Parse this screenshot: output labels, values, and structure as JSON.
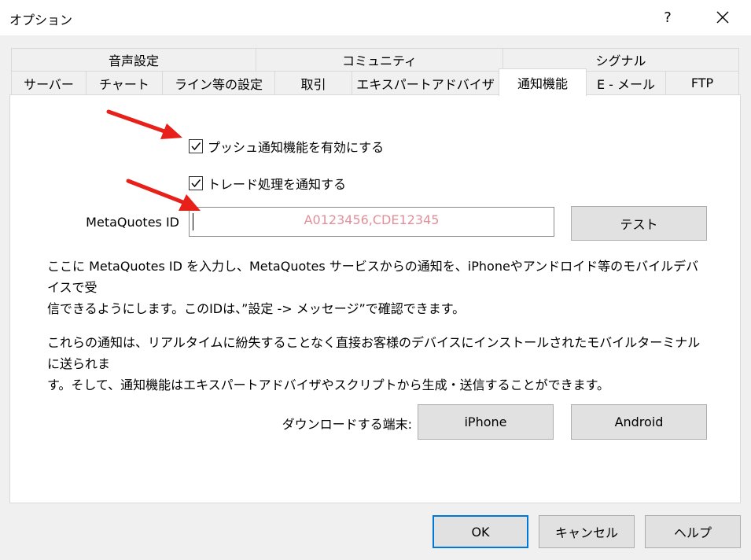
{
  "window": {
    "title": "オプション",
    "help_label": "?",
    "close_icon": "close-icon"
  },
  "tabs": {
    "row1": [
      {
        "label": "音声設定"
      },
      {
        "label": "コミュニティ"
      },
      {
        "label": "シグナル"
      }
    ],
    "row2": [
      {
        "label": "サーバー"
      },
      {
        "label": "チャート"
      },
      {
        "label": "ライン等の設定"
      },
      {
        "label": "取引"
      },
      {
        "label": "エキスパートアドバイザ"
      },
      {
        "label": "通知機能",
        "active": true
      },
      {
        "label": "E - メール"
      },
      {
        "label": "FTP"
      }
    ]
  },
  "notifications": {
    "push_checkbox": {
      "label": "プッシュ通知機能を有効にする",
      "checked": true
    },
    "trade_checkbox": {
      "label": "トレード処理を通知する",
      "checked": true
    },
    "id_label": "MetaQuotes ID",
    "id_value": "A0123456,CDE12345",
    "test_button": "テスト",
    "description1_line1": "ここに MetaQuotes ID を入力し、MetaQuotes サービスからの通知を、iPhoneやアンドロイド等のモバイルデバイスで受",
    "description1_line2": "信できるようにします。このIDは、”設定 -> メッセージ”で確認できます。",
    "description2_line1": "これらの通知は、リアルタイムに紛失することなく直接お客様のデバイスにインストールされたモバイルターミナルに送られま",
    "description2_line2": "す。そして、通知機能はエキスパートアドバイザやスクリプトから生成・送信することができます。",
    "download_label": "ダウンロードする端末:",
    "iphone_button": "iPhone",
    "android_button": "Android"
  },
  "footer": {
    "ok_button": "OK",
    "cancel_button": "キャンセル",
    "help_button": "ヘルプ"
  },
  "colors": {
    "accent": "#0078d7",
    "annotation_arrow": "#e8201a",
    "id_text": "#e0909a"
  }
}
